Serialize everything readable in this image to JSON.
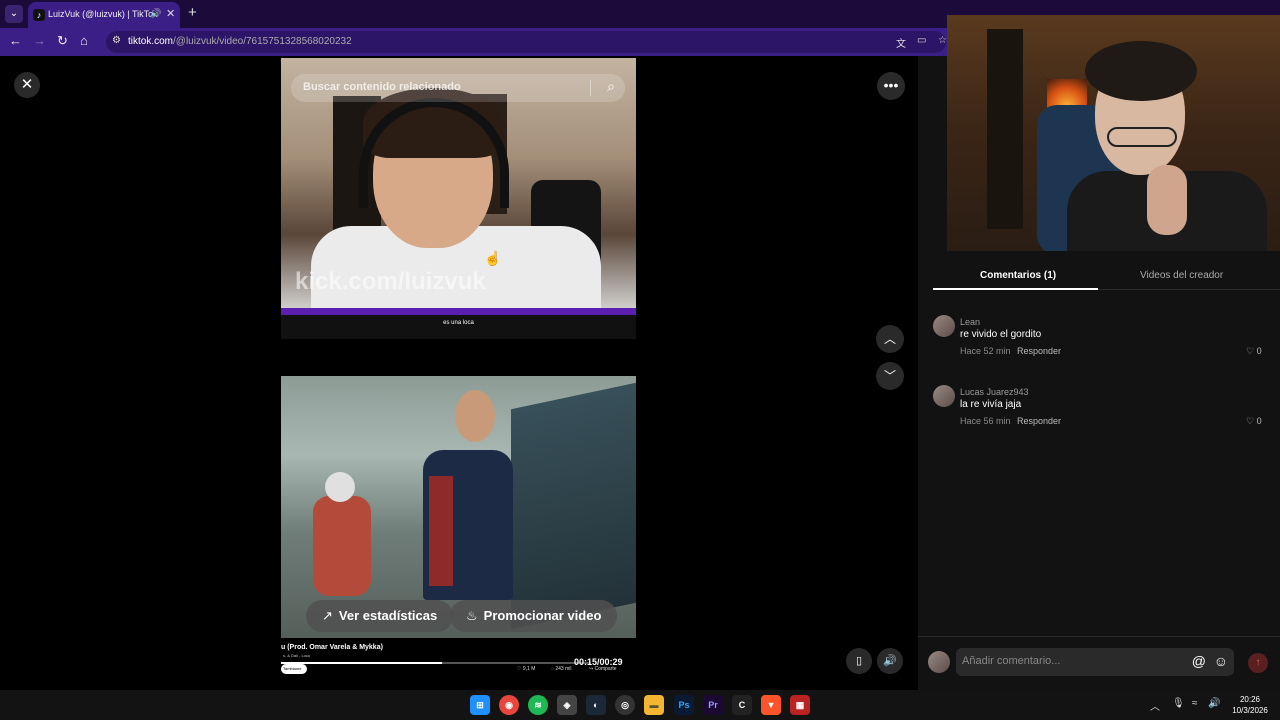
{
  "browser": {
    "tab_title": "LuizVuk (@luizvuk) | TikTok",
    "url_host": "tiktok.com",
    "url_path": "/@luizvuk/video/7615751328568020232"
  },
  "video": {
    "search_placeholder": "Buscar contenido relacionado",
    "watermark": "kick.com/luizvuk",
    "caption": "es una loca",
    "stats_button": "Ver estadísticas",
    "promote_button": "Promocionar video",
    "song_title": "u (Prod. Omar Varela & Mykka)",
    "song_sub": "s, & Dali - Loco",
    "time": "00:15/00:29",
    "progress": 0.52,
    "mini_likes": "9,1 M",
    "mini_comments": "243 mil",
    "mini_share": "Comparte",
    "mini_pill": "Tambiame"
  },
  "panel": {
    "tab_comments": "Comentarios (1)",
    "tab_creator": "Videos del creador",
    "comments": [
      {
        "user": "Lean",
        "text": "re vivido el gordito",
        "time": "Hace 52 min",
        "reply": "Responder",
        "likes": "0"
      },
      {
        "user": "Lucas Juarez943",
        "text": "la re vivía jaja",
        "time": "Hace 56 min",
        "reply": "Responder",
        "likes": "0"
      }
    ],
    "comment_placeholder": "Añadir comentario..."
  },
  "taskbar": {
    "time": "20:26",
    "date": "10/3/2026"
  },
  "colors": {
    "browser_chrome": "#3c1f86",
    "accent_purple": "#5a1fb1",
    "panel_bg": "#121212"
  }
}
